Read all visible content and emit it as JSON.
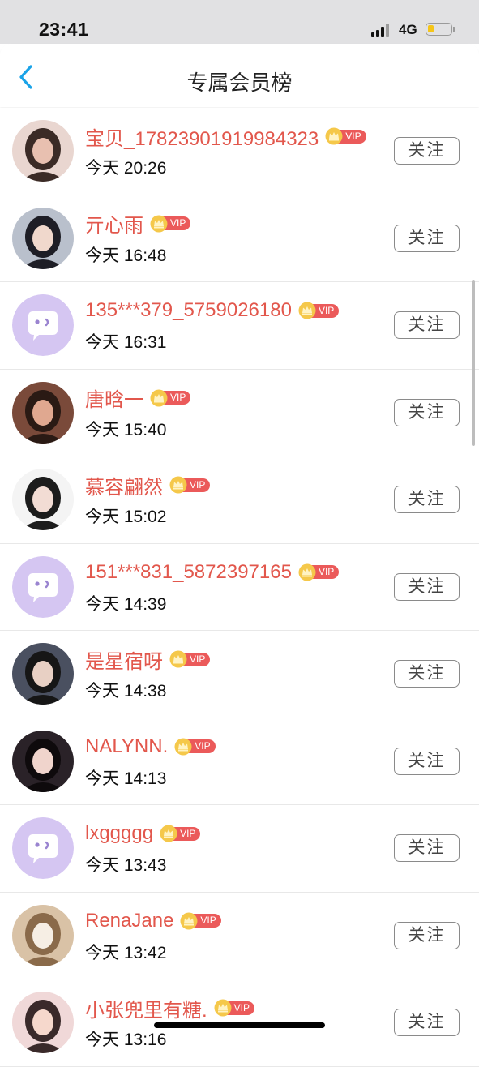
{
  "status_bar": {
    "time": "23:41",
    "network": "4G",
    "battery_level": 0.25
  },
  "header": {
    "title": "专属会员榜",
    "back_icon": "chevron-left-icon"
  },
  "colors": {
    "name_accent": "#e2574c",
    "vip_badge": "#eb5a5a",
    "crown": "#f5c84a",
    "default_avatar_bg": "#d5c6f2",
    "back_icon": "#1aa3e8"
  },
  "vip_label": "VIP",
  "follow_label": "关注",
  "members": [
    {
      "name": "宝贝_17823901919984323",
      "time": "今天 20:26",
      "avatar": "photo"
    },
    {
      "name": "亓心雨",
      "time": "今天 16:48",
      "avatar": "photo"
    },
    {
      "name": "135***379_5759026180",
      "time": "今天 16:31",
      "avatar": "default"
    },
    {
      "name": "唐晗一",
      "time": "今天 15:40",
      "avatar": "photo"
    },
    {
      "name": "慕容翩然",
      "time": "今天 15:02",
      "avatar": "photo"
    },
    {
      "name": "151***831_5872397165",
      "time": "今天 14:39",
      "avatar": "default"
    },
    {
      "name": "是星宿呀",
      "time": "今天 14:38",
      "avatar": "photo"
    },
    {
      "name": "NALYNN.",
      "time": "今天 14:13",
      "avatar": "photo"
    },
    {
      "name": "lxggggg",
      "time": "今天 13:43",
      "avatar": "default"
    },
    {
      "name": "RenaJane",
      "time": "今天 13:42",
      "avatar": "photo"
    },
    {
      "name": "小张兜里有糖.",
      "time": "今天 13:16",
      "avatar": "photo"
    }
  ]
}
